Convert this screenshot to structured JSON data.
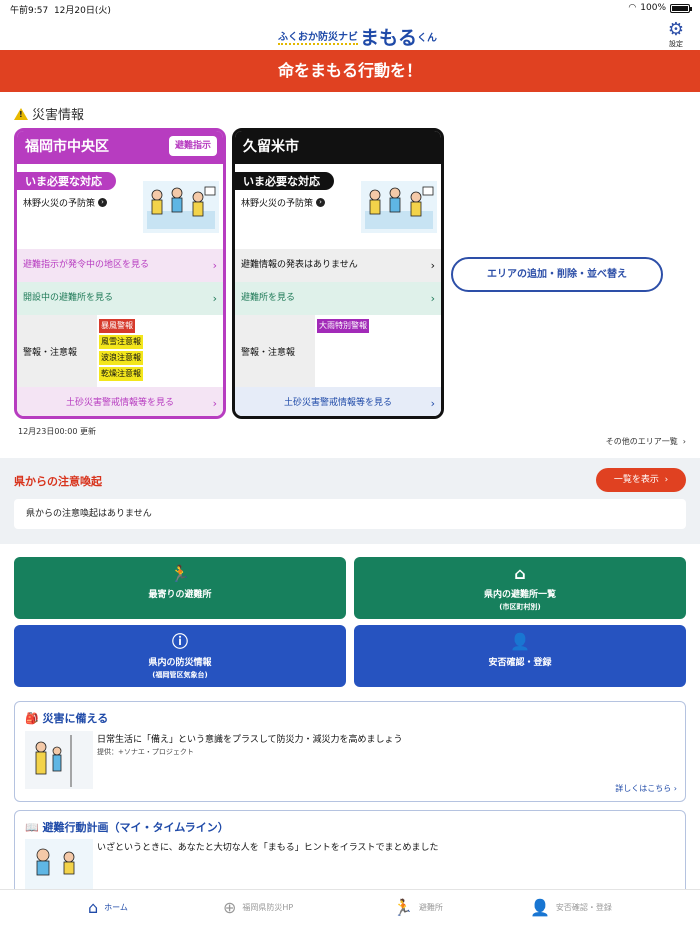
{
  "status": {
    "time": "午前9:57",
    "date": "12月20日(火)",
    "battery": "100%",
    "battery_level": 1.0
  },
  "header": {
    "logo_small": "ふくおか防災ナビ",
    "logo_big": "まもる",
    "logo_kun": "くん",
    "settings_label": "設定"
  },
  "banner": "命をまもる行動を！",
  "disaster_info": {
    "title": "災害情報",
    "cards": [
      {
        "name": "福岡市中央区",
        "badge": "避難指示",
        "need_tag": "いま必要な対応",
        "need_link": "林野火災の予防策",
        "evac_row": "避難指示が発令中の地区を見る",
        "shelter_row": "開設中の避難所を見る",
        "warn_label": "警報・注意報",
        "warnings": [
          "暴風警報",
          "風雪注意報",
          "波浪注意報",
          "乾燥注意報"
        ],
        "sediment_row": "土砂災害警戒情報等を見る"
      },
      {
        "name": "久留米市",
        "need_tag": "いま必要な対応",
        "need_link": "林野火災の予防策",
        "evac_row": "避難情報の発表はありません",
        "shelter_row": "避難所を見る",
        "warn_label": "警報・注意報",
        "warnings": [
          "大雨特別警報"
        ],
        "sediment_row": "土砂災害警戒情報等を見る"
      }
    ],
    "add_area_button": "エリアの追加・削除・並べ替え",
    "updated": "12月23日00:00 更新",
    "other_areas": "その他のエリア一覧"
  },
  "prefecture": {
    "title": "県からの注意喚起",
    "list_button": "一覧を表示",
    "message": "県からの注意喚起はありません"
  },
  "tiles": {
    "nearest": "最寄りの避難所",
    "shelter_list": "県内の避難所一覧",
    "shelter_list_sub": "(市区町村別)",
    "bousai_info": "県内の防災情報",
    "bousai_info_sub": "(福岡管区気象台)",
    "safety": "安否確認・登録"
  },
  "prepare": {
    "title": "災害に備える",
    "text": "日常生活に「備え」という意識をプラスして防災力・減災力を高めましょう",
    "provider": "提供：+ソナエ・プロジェクト",
    "more": "詳しくはこちら"
  },
  "timeline": {
    "title": "避難行動計画（マイ・タイムライン）",
    "text": "いざというときに、あなたと大切な人を「まもる」ヒントをイラストでまとめました"
  },
  "tabbar": {
    "home": "ホーム",
    "hp": "福岡県防災HP",
    "shelter": "避難所",
    "safety": "安否確認・登録"
  },
  "colors": {
    "brand_blue": "#1f4aa8",
    "alert_red": "#e04121",
    "card_purple": "#b73cc0",
    "tile_green": "#17805d",
    "tile_blue": "#2653c0"
  }
}
